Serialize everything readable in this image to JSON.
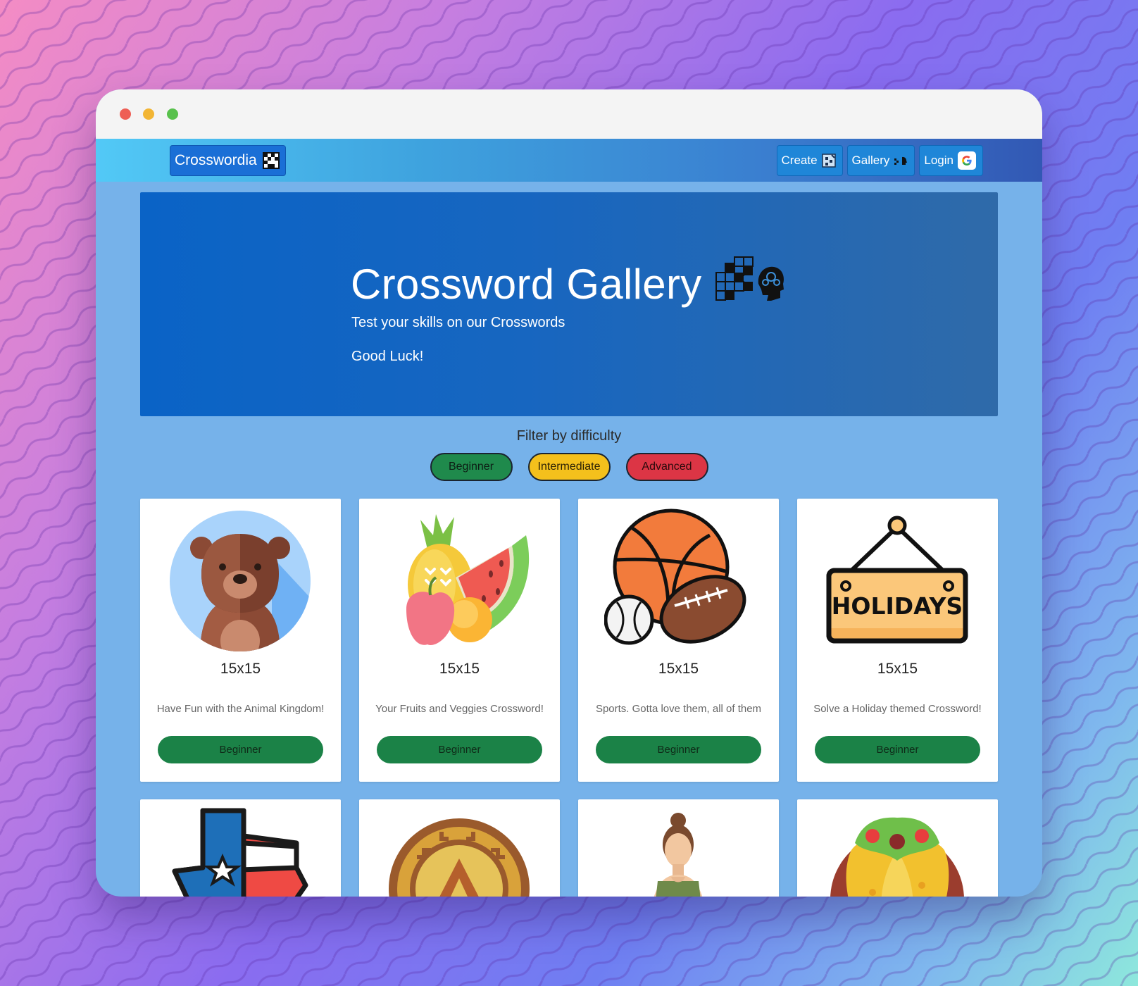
{
  "navbar": {
    "brand": "Crosswordia",
    "create_label": "Create",
    "gallery_label": "Gallery",
    "login_label": "Login"
  },
  "hero": {
    "title": "Crossword Gallery",
    "subtitle": "Test your skills on our Crosswords",
    "tagline": "Good Luck!"
  },
  "filter": {
    "title": "Filter by difficulty",
    "options": [
      "Beginner",
      "Intermediate",
      "Advanced"
    ]
  },
  "cards": [
    {
      "icon": "bear-icon",
      "size": "15x15",
      "description": "Have Fun with the Animal Kingdom!",
      "difficulty": "Beginner"
    },
    {
      "icon": "fruits-icon",
      "size": "15x15",
      "description": "Your Fruits and Veggies Crossword!",
      "difficulty": "Beginner"
    },
    {
      "icon": "sports-balls-icon",
      "size": "15x15",
      "description": "Sports. Gotta love them, all of them",
      "difficulty": "Beginner"
    },
    {
      "icon": "holidays-sign-icon",
      "size": "15x15",
      "description": "Solve a Holiday themed Crossword!",
      "difficulty": "Beginner"
    },
    {
      "icon": "texas-map-icon"
    },
    {
      "icon": "aztec-calendar-icon"
    },
    {
      "icon": "woman-avatar-icon"
    },
    {
      "icon": "burrito-icon"
    }
  ],
  "holiday_sign_text": "HOLIDAYS",
  "colors": {
    "beginner": "#1f8a4c",
    "intermediate": "#f4c01c",
    "advanced": "#dc3545",
    "hero": "#1766c0"
  }
}
